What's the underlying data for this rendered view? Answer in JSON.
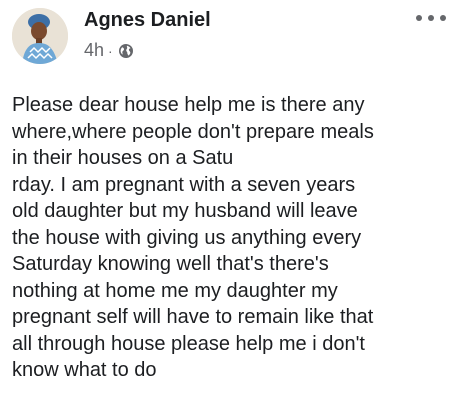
{
  "post": {
    "author": "Agnes Daniel",
    "time": "4h",
    "separator": "·",
    "privacy_icon": "globe-icon",
    "more_icon": "more-options-icon",
    "lines": [
      "Please dear house help me is there any",
      "where,where people don't prepare meals",
      "in their houses on a Satu",
      "rday. I am pregnant with a seven years",
      "old daughter but my husband will leave",
      "the house with giving us anything every",
      "Saturday knowing well that's there's",
      "nothing at home me my daughter my",
      "pregnant self will have to remain like that",
      "all through house please help me i don't",
      "know what to do"
    ]
  },
  "colors": {
    "text": "#1c1e21",
    "secondary": "#65676b",
    "avatar_bg": "#e9e2d6",
    "avatar_dress": "#6fa8d6"
  }
}
